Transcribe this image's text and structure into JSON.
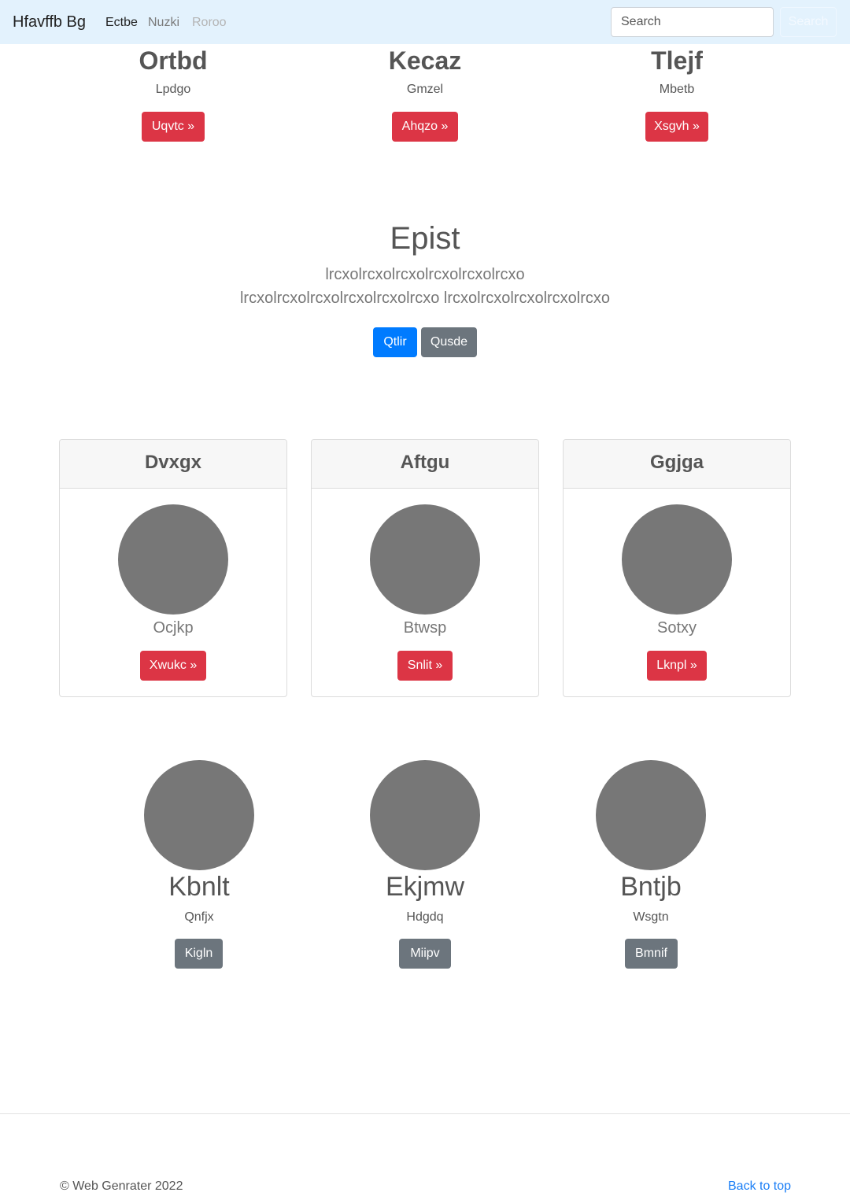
{
  "navbar": {
    "brand": "Hfavffb Bg",
    "links": [
      "Ectbe",
      "Nuzki",
      "Roroo"
    ],
    "search_placeholder": "Search",
    "search_button": "Search"
  },
  "top_columns": [
    {
      "title": "Ortbd",
      "subtitle": "Lpdgo",
      "button": "Uqvtc »"
    },
    {
      "title": "Kecaz",
      "subtitle": "Gmzel",
      "button": "Ahqzo »"
    },
    {
      "title": "Tlejf",
      "subtitle": "Mbetb",
      "button": "Xsgvh »"
    }
  ],
  "jumbotron": {
    "title": "Epist",
    "lead": "lrcxolrcxolrcxolrcxolrcxolrcxo lrcxolrcxolrcxolrcxolrcxolrcxo lrcxolrcxolrcxolrcxolrcxo",
    "primary_button": "Qtlir",
    "secondary_button": "Qusde"
  },
  "cards": [
    {
      "header": "Dvxgx",
      "name": "Ocjkp",
      "button": "Xwukc »"
    },
    {
      "header": "Aftgu",
      "name": "Btwsp",
      "button": "Snlit »"
    },
    {
      "header": "Ggjga",
      "name": "Sotxy",
      "button": "Lknpl »"
    }
  ],
  "people": [
    {
      "name": "Kbnlt",
      "subtitle": "Qnfjx",
      "button": "Kigln"
    },
    {
      "name": "Ekjmw",
      "subtitle": "Hdgdq",
      "button": "Miipv"
    },
    {
      "name": "Bntjb",
      "subtitle": "Wsgtn",
      "button": "Bmnif"
    }
  ],
  "footer": {
    "copyright": "© Web Genrater 2022",
    "back_to_top": "Back to top"
  },
  "colors": {
    "navbar_bg": "#e3f2fd",
    "danger": "#dc3545",
    "primary": "#007bff",
    "secondary": "#6c757d",
    "placeholder_circle": "#777777",
    "link": "#1a7ef6"
  }
}
